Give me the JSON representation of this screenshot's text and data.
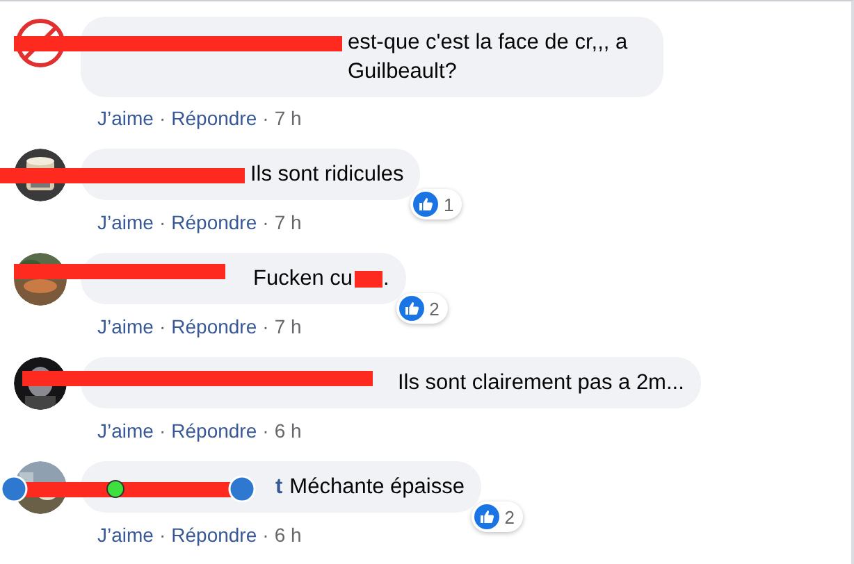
{
  "comments": [
    {
      "kind": "bar",
      "text": "est-que c'est la face de cr,,, a Guilbeault?",
      "actions": [
        {
          "kind": "link",
          "text": "J’aime"
        },
        {
          "kind": "dot",
          "text": "·"
        },
        {
          "kind": "link",
          "text": "Répondre"
        },
        {
          "kind": "dot",
          "text": "·"
        },
        {
          "kind": "time",
          "text": "7 h"
        }
      ]
    },
    {
      "kind": "bar",
      "text": "Ils sont ridicules",
      "reaction": {
        "kind": "like",
        "count": "1"
      },
      "actions": [
        {
          "kind": "link",
          "text": "J’aime"
        },
        {
          "kind": "dot",
          "text": "·"
        },
        {
          "kind": "link",
          "text": "Répondre"
        },
        {
          "kind": "dot",
          "text": "·"
        },
        {
          "kind": "time",
          "text": "7 h"
        }
      ]
    },
    {
      "kind": "bar",
      "text": "Fucken cu",
      "text_after": ".",
      "reaction": {
        "kind": "like",
        "count": "2"
      },
      "actions": [
        {
          "kind": "link",
          "text": "J’aime"
        },
        {
          "kind": "dot",
          "text": "·"
        },
        {
          "kind": "link",
          "text": "Répondre"
        },
        {
          "kind": "dot",
          "text": "·"
        },
        {
          "kind": "time",
          "text": "7 h"
        }
      ]
    },
    {
      "kind": "bar",
      "text": "Ils sont clairement pas a 2m...",
      "actions": [
        {
          "kind": "link",
          "text": "J’aime"
        },
        {
          "kind": "dot",
          "text": "·"
        },
        {
          "kind": "link",
          "text": "Répondre"
        },
        {
          "kind": "dot",
          "text": "·"
        },
        {
          "kind": "time",
          "text": "6 h"
        }
      ]
    },
    {
      "kind": "dotted",
      "name_visible": "t",
      "text": "Méchante épaisse",
      "reaction": {
        "kind": "like",
        "count": "2"
      },
      "actions": [
        {
          "kind": "link",
          "text": "J’aime"
        },
        {
          "kind": "dot",
          "text": "·"
        },
        {
          "kind": "link",
          "text": "Répondre"
        },
        {
          "kind": "dot",
          "text": "·"
        },
        {
          "kind": "time",
          "text": "6 h"
        }
      ]
    }
  ]
}
